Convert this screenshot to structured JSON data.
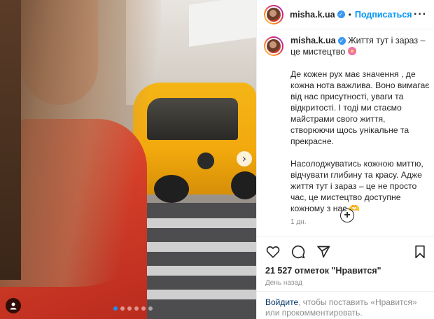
{
  "post": {
    "username": "misha.k.ua",
    "follow_label": "Подписаться",
    "separator": "•",
    "more_icon": "more-horizontal-icon",
    "caption_title": "Життя тут і зараз – це мистецтво",
    "paragraph1": "Де кожен рух має значення , де кожна нота важлива. Воно вимагає від нас присутності, уваги та відкритості. І тоді ми стаємо майстрами свого життя, створюючи щось унікальне та прекрасне.",
    "paragraph2": "Насолоджуватись кожною миттю, відчувати глибину та красу. Адже життя тут і зараз – це не просто час, це мистецтво доступне кожному з нас 🫶",
    "caption_time": "1 дн.",
    "likes": "21 527 отметок \"Нравится\"",
    "posted_ago": "День назад",
    "login_link": "Войдите",
    "login_rest": ", чтобы поставить «Нравится» или прокомментировать."
  },
  "carousel": {
    "total": 6,
    "active": 0
  },
  "icons": {
    "like": "heart-icon",
    "comment": "comment-icon",
    "share": "send-icon",
    "save": "bookmark-icon",
    "add": "plus-circle-icon",
    "next": "chevron-right-icon",
    "tag": "person-tag-icon"
  },
  "colors": {
    "accent": "#0095f6",
    "verified": "#3897f0",
    "muted": "#8e8e8e",
    "text": "#262626"
  }
}
